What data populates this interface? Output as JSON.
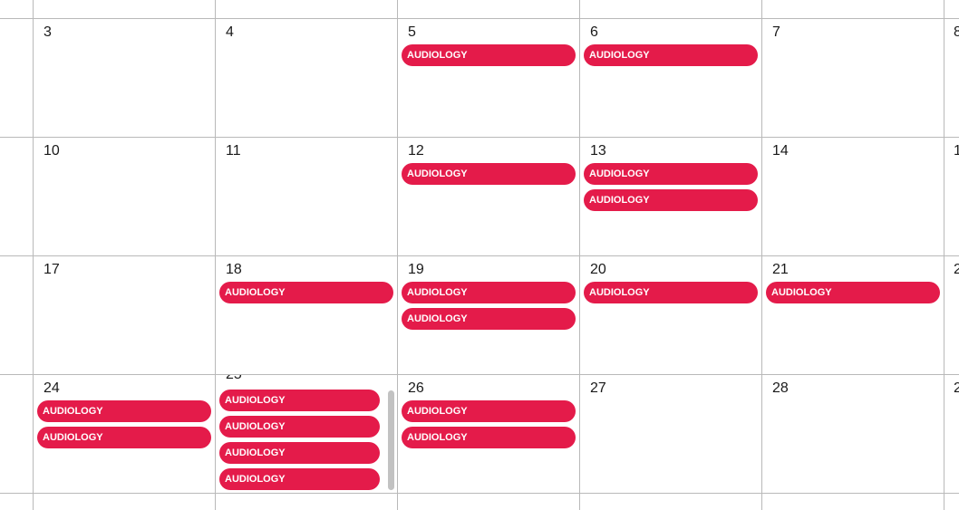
{
  "accent_color": "#e41b4a",
  "event_label": "AUDIOLOGY",
  "weeks": [
    {
      "days": [
        {
          "num": "3",
          "events": []
        },
        {
          "num": "4",
          "events": []
        },
        {
          "num": "5",
          "events": [
            "AUDIOLOGY"
          ]
        },
        {
          "num": "6",
          "events": [
            "AUDIOLOGY"
          ]
        },
        {
          "num": "7",
          "events": []
        },
        {
          "num": "8",
          "events": []
        }
      ]
    },
    {
      "days": [
        {
          "num": "10",
          "events": []
        },
        {
          "num": "11",
          "events": []
        },
        {
          "num": "12",
          "events": [
            "AUDIOLOGY"
          ]
        },
        {
          "num": "13",
          "events": [
            "AUDIOLOGY",
            "AUDIOLOGY"
          ]
        },
        {
          "num": "14",
          "events": []
        },
        {
          "num": "1",
          "events": []
        }
      ]
    },
    {
      "days": [
        {
          "num": "17",
          "events": []
        },
        {
          "num": "18",
          "events": [
            "AUDIOLOGY"
          ]
        },
        {
          "num": "19",
          "events": [
            "AUDIOLOGY",
            "AUDIOLOGY"
          ]
        },
        {
          "num": "20",
          "events": [
            "AUDIOLOGY"
          ]
        },
        {
          "num": "21",
          "events": [
            "AUDIOLOGY"
          ]
        },
        {
          "num": "2",
          "events": []
        }
      ]
    },
    {
      "days": [
        {
          "num": "24",
          "events": [
            "AUDIOLOGY",
            "AUDIOLOGY"
          ]
        },
        {
          "num": "25",
          "events": [
            "AUDIOLOGY",
            "AUDIOLOGY",
            "AUDIOLOGY",
            "AUDIOLOGY"
          ],
          "scrollable": true
        },
        {
          "num": "26",
          "events": [
            "AUDIOLOGY",
            "AUDIOLOGY"
          ]
        },
        {
          "num": "27",
          "events": []
        },
        {
          "num": "28",
          "events": []
        },
        {
          "num": "2",
          "events": []
        }
      ]
    }
  ]
}
